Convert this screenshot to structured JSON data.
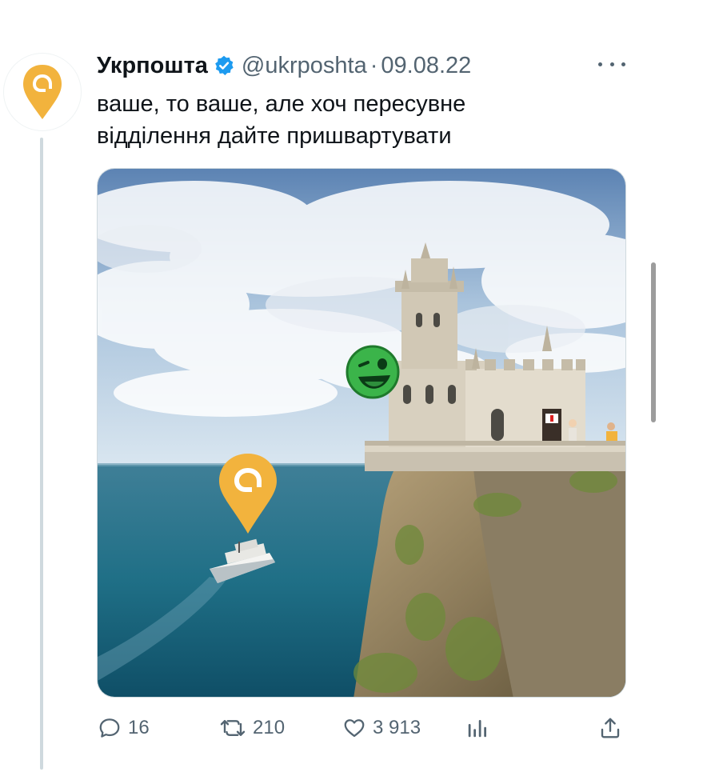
{
  "tweet": {
    "author_name": "Укрпошта",
    "handle": "@ukrposhta",
    "separator": "·",
    "date": "09.08.22",
    "text_line1": "ваше, то ваше, але хоч пересувне",
    "text_line2": "відділення дайте пришвартувати",
    "avatar_icon": "ukrposhta-logo-icon",
    "verified_icon": "verified-badge-icon",
    "more_icon": "more-dots-icon"
  },
  "media": {
    "description_icon": "castle-photo-image"
  },
  "actions": {
    "replies": "16",
    "retweets": "210",
    "likes": "3 913",
    "views_icon": "analytics-icon",
    "share_icon": "share-icon"
  },
  "colors": {
    "brand_yellow": "#f2b33d",
    "verified_blue": "#1d9bf0",
    "secondary_text": "#536471",
    "thread_line": "#cfd9de"
  }
}
